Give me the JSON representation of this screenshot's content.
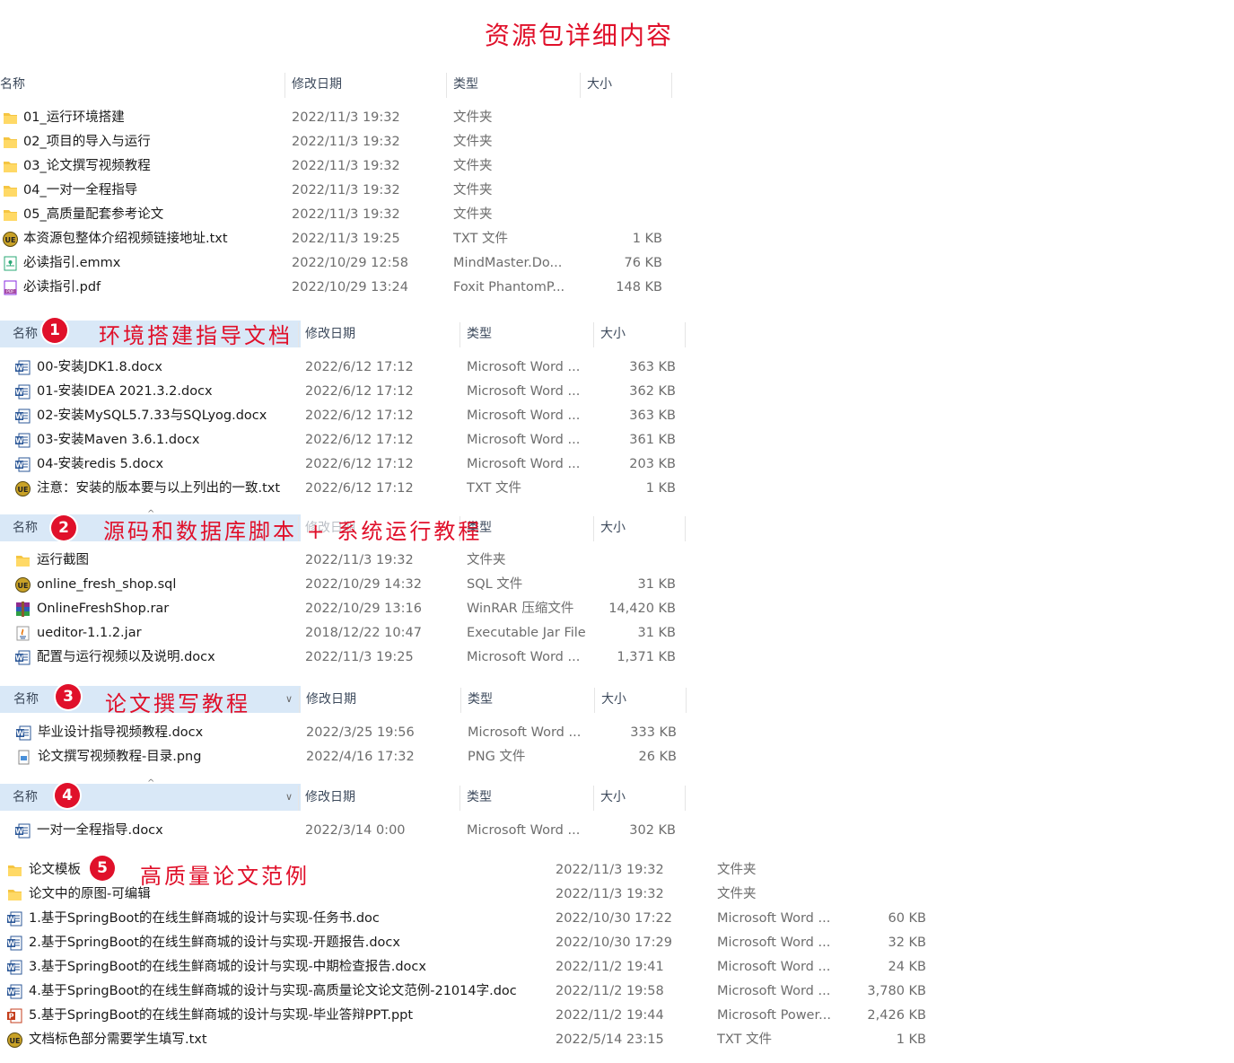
{
  "title": "资源包详细内容",
  "colors": {
    "accent": "#e0102a",
    "header_selected": "#d9e8f7",
    "folder": "#f5c542",
    "word": "#2b5797"
  },
  "headers": {
    "name": "名称",
    "date": "修改日期",
    "type": "类型",
    "size": "大小"
  },
  "top_list": [
    {
      "name": "01_运行环境搭建",
      "date": "2022/11/3 19:32",
      "type": "文件夹",
      "size": "",
      "icon": "folder-icon"
    },
    {
      "name": "02_项目的导入与运行",
      "date": "2022/11/3 19:32",
      "type": "文件夹",
      "size": "",
      "icon": "folder-icon"
    },
    {
      "name": "03_论文撰写视频教程",
      "date": "2022/11/3 19:32",
      "type": "文件夹",
      "size": "",
      "icon": "folder-icon"
    },
    {
      "name": "04_一对一全程指导",
      "date": "2022/11/3 19:32",
      "type": "文件夹",
      "size": "",
      "icon": "folder-icon"
    },
    {
      "name": "05_高质量配套参考论文",
      "date": "2022/11/3 19:32",
      "type": "文件夹",
      "size": "",
      "icon": "folder-icon"
    },
    {
      "name": "本资源包整体介绍视频链接地址.txt",
      "date": "2022/11/3 19:25",
      "type": "TXT 文件",
      "size": "1 KB",
      "icon": "ue-icon"
    },
    {
      "name": "必读指引.emmx",
      "date": "2022/10/29 12:58",
      "type": "MindMaster.Do...",
      "size": "76 KB",
      "icon": "mindmaster-icon"
    },
    {
      "name": "必读指引.pdf",
      "date": "2022/10/29 13:24",
      "type": "Foxit PhantomP...",
      "size": "148 KB",
      "icon": "pdf-icon"
    }
  ],
  "section1": {
    "badge": "1",
    "callout": "环境搭建指导文档",
    "rows": [
      {
        "name": "00-安装JDK1.8.docx",
        "date": "2022/6/12 17:12",
        "type": "Microsoft Word ...",
        "size": "363 KB",
        "icon": "word-icon"
      },
      {
        "name": "01-安装IDEA 2021.3.2.docx",
        "date": "2022/6/12 17:12",
        "type": "Microsoft Word ...",
        "size": "362 KB",
        "icon": "word-icon"
      },
      {
        "name": "02-安装MySQL5.7.33与SQLyog.docx",
        "date": "2022/6/12 17:12",
        "type": "Microsoft Word ...",
        "size": "363 KB",
        "icon": "word-icon"
      },
      {
        "name": "03-安装Maven 3.6.1.docx",
        "date": "2022/6/12 17:12",
        "type": "Microsoft Word ...",
        "size": "361 KB",
        "icon": "word-icon"
      },
      {
        "name": "04-安装redis 5.docx",
        "date": "2022/6/12 17:12",
        "type": "Microsoft Word ...",
        "size": "203 KB",
        "icon": "word-icon"
      },
      {
        "name": "注意：安装的版本要与以上列出的一致.txt",
        "date": "2022/6/12 17:12",
        "type": "TXT 文件",
        "size": "1 KB",
        "icon": "ue-icon"
      }
    ]
  },
  "section2": {
    "badge": "2",
    "callout": "源码和数据库脚本 + 系统运行教程",
    "rows": [
      {
        "name": "运行截图",
        "date": "2022/11/3 19:32",
        "type": "文件夹",
        "size": "",
        "icon": "folder-icon"
      },
      {
        "name": "online_fresh_shop.sql",
        "date": "2022/10/29 14:32",
        "type": "SQL 文件",
        "size": "31 KB",
        "icon": "ue-icon"
      },
      {
        "name": "OnlineFreshShop.rar",
        "date": "2022/10/29 13:16",
        "type": "WinRAR 压缩文件",
        "size": "14,420 KB",
        "icon": "winrar-icon"
      },
      {
        "name": "ueditor-1.1.2.jar",
        "date": "2018/12/22 10:47",
        "type": "Executable Jar File",
        "size": "31 KB",
        "icon": "java-icon"
      },
      {
        "name": "配置与运行视频以及说明.docx",
        "date": "2022/11/3 19:25",
        "type": "Microsoft Word ...",
        "size": "1,371 KB",
        "icon": "word-icon"
      }
    ]
  },
  "section3": {
    "badge": "3",
    "callout": "论文撰写教程",
    "rows": [
      {
        "name": "毕业设计指导视频教程.docx",
        "date": "2022/3/25 19:56",
        "type": "Microsoft Word ...",
        "size": "333 KB",
        "icon": "word-icon"
      },
      {
        "name": "论文撰写视频教程-目录.png",
        "date": "2022/4/16 17:32",
        "type": "PNG 文件",
        "size": "26 KB",
        "icon": "png-icon"
      }
    ]
  },
  "section4": {
    "badge": "4",
    "rows": [
      {
        "name": "一对一全程指导.docx",
        "date": "2022/3/14 0:00",
        "type": "Microsoft Word ...",
        "size": "302 KB",
        "icon": "word-icon"
      }
    ]
  },
  "section5": {
    "badge": "5",
    "callout": "高质量论文范例",
    "rows": [
      {
        "name": "论文模板",
        "date": "2022/11/3 19:32",
        "type": "文件夹",
        "size": "",
        "icon": "folder-icon"
      },
      {
        "name": "论文中的原图-可编辑",
        "date": "2022/11/3 19:32",
        "type": "文件夹",
        "size": "",
        "icon": "folder-icon"
      },
      {
        "name": "1.基于SpringBoot的在线生鲜商城的设计与实现-任务书.doc",
        "date": "2022/10/30 17:22",
        "type": "Microsoft Word ...",
        "size": "60 KB",
        "icon": "word-icon"
      },
      {
        "name": "2.基于SpringBoot的在线生鲜商城的设计与实现-开题报告.docx",
        "date": "2022/10/30 17:29",
        "type": "Microsoft Word ...",
        "size": "32 KB",
        "icon": "word-icon"
      },
      {
        "name": "3.基于SpringBoot的在线生鲜商城的设计与实现-中期检查报告.docx",
        "date": "2022/11/2 19:41",
        "type": "Microsoft Word ...",
        "size": "24 KB",
        "icon": "word-icon"
      },
      {
        "name": "4.基于SpringBoot的在线生鲜商城的设计与实现-高质量论文论文范例-21014字.doc",
        "date": "2022/11/2 19:58",
        "type": "Microsoft Word ...",
        "size": "3,780 KB",
        "icon": "word-icon"
      },
      {
        "name": "5.基于SpringBoot的在线生鲜商城的设计与实现-毕业答辩PPT.ppt",
        "date": "2022/11/2 19:44",
        "type": "Microsoft Power...",
        "size": "2,426 KB",
        "icon": "ppt-icon"
      },
      {
        "name": "文档标色部分需要学生填写.txt",
        "date": "2022/5/14 23:15",
        "type": "TXT 文件",
        "size": "1 KB",
        "icon": "ue-icon"
      }
    ]
  }
}
